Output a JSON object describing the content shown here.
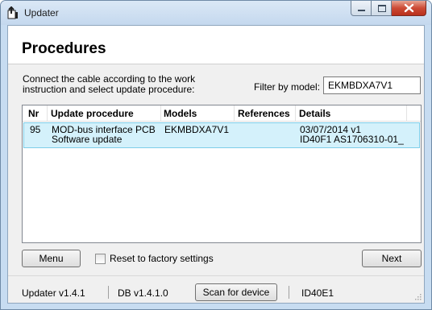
{
  "window": {
    "title": "Updater"
  },
  "header": {
    "title": "Procedures"
  },
  "instructions": {
    "line1": "Connect the cable according to the work",
    "line2": "instruction and select update procedure:"
  },
  "filter": {
    "label": "Filter by model:",
    "value": "EKMBDXA7V1"
  },
  "table": {
    "columns": [
      "Nr",
      "Update procedure",
      "Models",
      "References",
      "Details"
    ],
    "rows": [
      {
        "nr": "95",
        "procedure_line1": "MOD-bus interface PCB",
        "procedure_line2": "Software update",
        "models": "EKMBDXA7V1",
        "references": "",
        "details_line1": "03/07/2014 v1",
        "details_line2": "ID40F1 AS1706310-01_"
      }
    ]
  },
  "buttons": {
    "menu": "Menu",
    "next": "Next",
    "scan": "Scan for device"
  },
  "reset": {
    "label": "Reset to factory settings",
    "checked": false
  },
  "status": {
    "updater_version": "Updater v1.4.1",
    "db_version": "DB v1.4.1.0",
    "device_id": "ID40E1"
  },
  "colors": {
    "selection": "#d4f1fb",
    "selection_border": "#7ecde8",
    "close_button": "#cc4a35"
  },
  "icons": {
    "app": "updater-app-icon",
    "minimize": "minimize-icon",
    "maximize": "maximize-icon",
    "close": "close-icon"
  }
}
